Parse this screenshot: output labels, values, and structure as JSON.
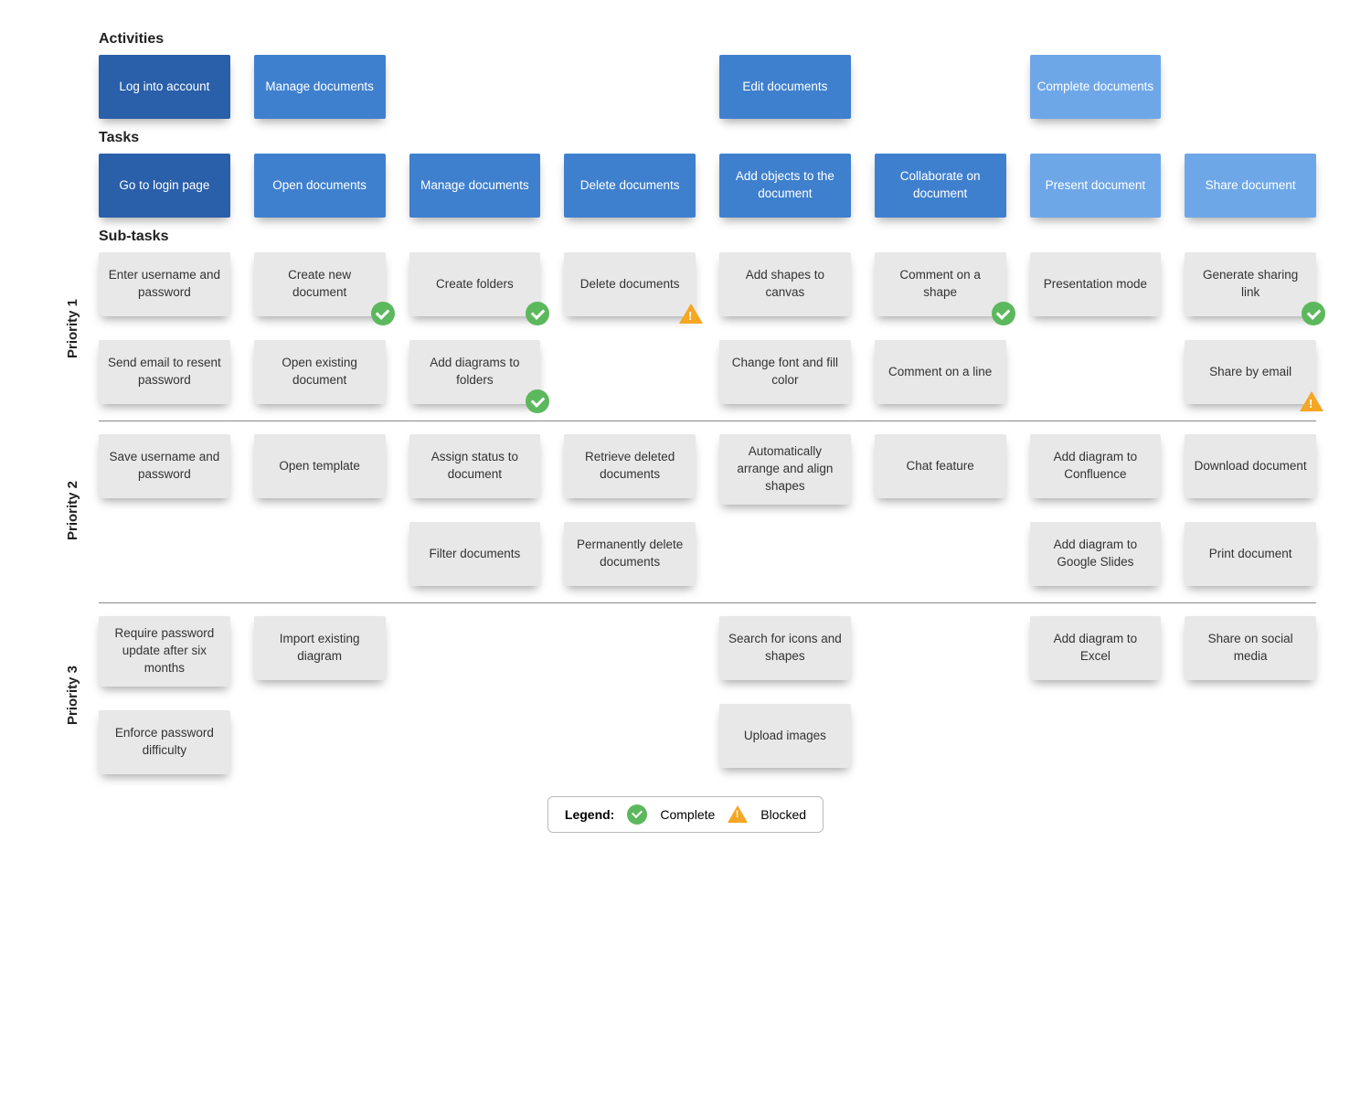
{
  "sections": {
    "activities_label": "Activities",
    "tasks_label": "Tasks",
    "subtasks_label": "Sub-tasks"
  },
  "activities": [
    {
      "label": "Log into account",
      "shade": "blue-d"
    },
    {
      "label": "Manage documents",
      "shade": "blue-m"
    },
    {
      "label": "",
      "shade": "empty"
    },
    {
      "label": "",
      "shade": "empty"
    },
    {
      "label": "Edit documents",
      "shade": "blue-m"
    },
    {
      "label": "",
      "shade": "empty"
    },
    {
      "label": "Complete documents",
      "shade": "blue-l"
    },
    {
      "label": "",
      "shade": "empty"
    }
  ],
  "tasks": [
    {
      "label": "Go to login page",
      "shade": "blue-d"
    },
    {
      "label": "Open documents",
      "shade": "blue-m"
    },
    {
      "label": "Manage documents",
      "shade": "blue-m"
    },
    {
      "label": "Delete documents",
      "shade": "blue-m"
    },
    {
      "label": "Add objects to the document",
      "shade": "blue-m"
    },
    {
      "label": "Collaborate on document",
      "shade": "blue-m"
    },
    {
      "label": "Present document",
      "shade": "blue-l"
    },
    {
      "label": "Share document",
      "shade": "blue-l"
    }
  ],
  "priorities": [
    {
      "label": "Priority 1",
      "rows": [
        [
          {
            "label": "Enter username and password"
          },
          {
            "label": "Create new document",
            "status": "complete"
          },
          {
            "label": "Create folders",
            "status": "complete"
          },
          {
            "label": "Delete documents",
            "status": "blocked"
          },
          {
            "label": "Add shapes to canvas"
          },
          {
            "label": "Comment on a shape",
            "status": "complete"
          },
          {
            "label": "Presentation mode"
          },
          {
            "label": "Generate sharing link",
            "status": "complete"
          }
        ],
        [
          {
            "label": "Send email to resent password"
          },
          {
            "label": "Open existing document"
          },
          {
            "label": "Add diagrams to folders",
            "status": "complete"
          },
          null,
          {
            "label": "Change font and fill color"
          },
          {
            "label": "Comment on a line"
          },
          null,
          {
            "label": "Share by email",
            "status": "blocked"
          }
        ]
      ]
    },
    {
      "label": "Priority 2",
      "rows": [
        [
          {
            "label": "Save username and password"
          },
          {
            "label": "Open template"
          },
          {
            "label": "Assign status to document"
          },
          {
            "label": "Retrieve deleted documents"
          },
          {
            "label": "Automatically arrange and align shapes"
          },
          {
            "label": "Chat feature"
          },
          {
            "label": "Add diagram to Confluence"
          },
          {
            "label": "Download document"
          }
        ],
        [
          null,
          null,
          {
            "label": "Filter documents"
          },
          {
            "label": "Permanently delete documents"
          },
          null,
          null,
          {
            "label": "Add diagram to Google Slides"
          },
          {
            "label": "Print document"
          }
        ]
      ]
    },
    {
      "label": "Priority 3",
      "rows": [
        [
          {
            "label": "Require password update after six months"
          },
          {
            "label": "Import existing diagram"
          },
          null,
          null,
          {
            "label": "Search for icons and shapes"
          },
          null,
          {
            "label": "Add diagram to Excel"
          },
          {
            "label": "Share on social media"
          }
        ],
        [
          {
            "label": "Enforce password difficulty"
          },
          null,
          null,
          null,
          {
            "label": "Upload images"
          },
          null,
          null,
          null
        ]
      ]
    }
  ],
  "legend": {
    "title": "Legend:",
    "complete": "Complete",
    "blocked": "Blocked"
  }
}
